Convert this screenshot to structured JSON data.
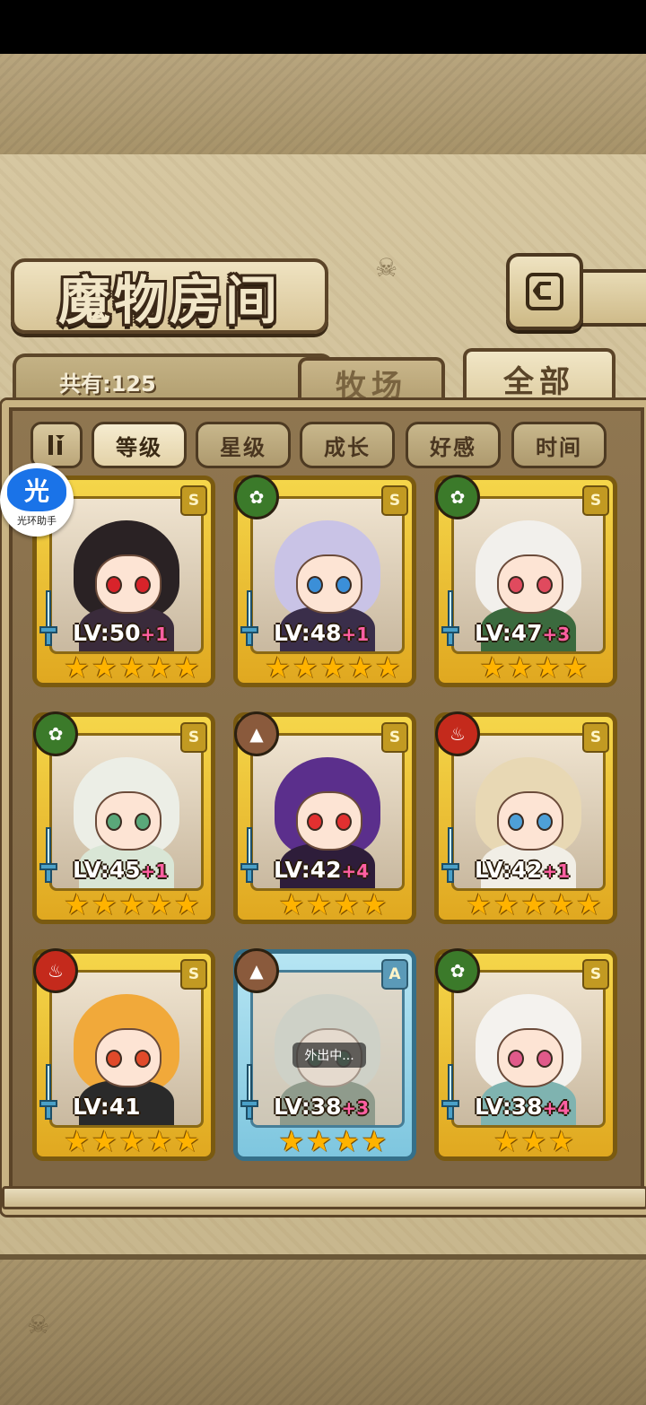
{
  "screen": {
    "title": "魔物房间",
    "count_label": "共有:125",
    "tabs": [
      {
        "label": "牧场",
        "active": false
      },
      {
        "label": "全部",
        "active": true
      }
    ],
    "filters": [
      {
        "label": "等级",
        "active": true
      },
      {
        "label": "星级",
        "active": false
      },
      {
        "label": "成长",
        "active": false
      },
      {
        "label": "好感",
        "active": false
      },
      {
        "label": "时间",
        "active": false
      }
    ]
  },
  "helper": {
    "label": "光环助手",
    "glyph": "光"
  },
  "colors": {
    "gold_card": "#f5d64a",
    "blue_card": "#b6e5f3",
    "plus_text": "#ff5fa2",
    "star": "#ffb300"
  },
  "cards": [
    {
      "level": "LV:50",
      "plus": "+1",
      "stars": 5,
      "rank": "S",
      "element": "none",
      "frame": "gold",
      "status": ""
    },
    {
      "level": "LV:48",
      "plus": "+1",
      "stars": 5,
      "rank": "S",
      "element": "nature",
      "frame": "gold",
      "status": ""
    },
    {
      "level": "LV:47",
      "plus": "+3",
      "stars": 4,
      "rank": "S",
      "element": "nature",
      "frame": "gold",
      "status": ""
    },
    {
      "level": "LV:45",
      "plus": "+1",
      "stars": 5,
      "rank": "S",
      "element": "nature",
      "frame": "gold",
      "status": ""
    },
    {
      "level": "LV:42",
      "plus": "+4",
      "stars": 4,
      "rank": "S",
      "element": "earth",
      "frame": "gold",
      "status": ""
    },
    {
      "level": "LV:42",
      "plus": "+1",
      "stars": 5,
      "rank": "S",
      "element": "fire",
      "frame": "gold",
      "status": ""
    },
    {
      "level": "LV:41",
      "plus": "",
      "stars": 5,
      "rank": "S",
      "element": "fire",
      "frame": "gold",
      "status": ""
    },
    {
      "level": "LV:38",
      "plus": "+3",
      "stars": 4,
      "rank": "A",
      "element": "earth",
      "frame": "blue",
      "status": "外出中..."
    },
    {
      "level": "LV:38",
      "plus": "+4",
      "stars": 3,
      "rank": "S",
      "element": "nature",
      "frame": "gold",
      "status": ""
    }
  ]
}
